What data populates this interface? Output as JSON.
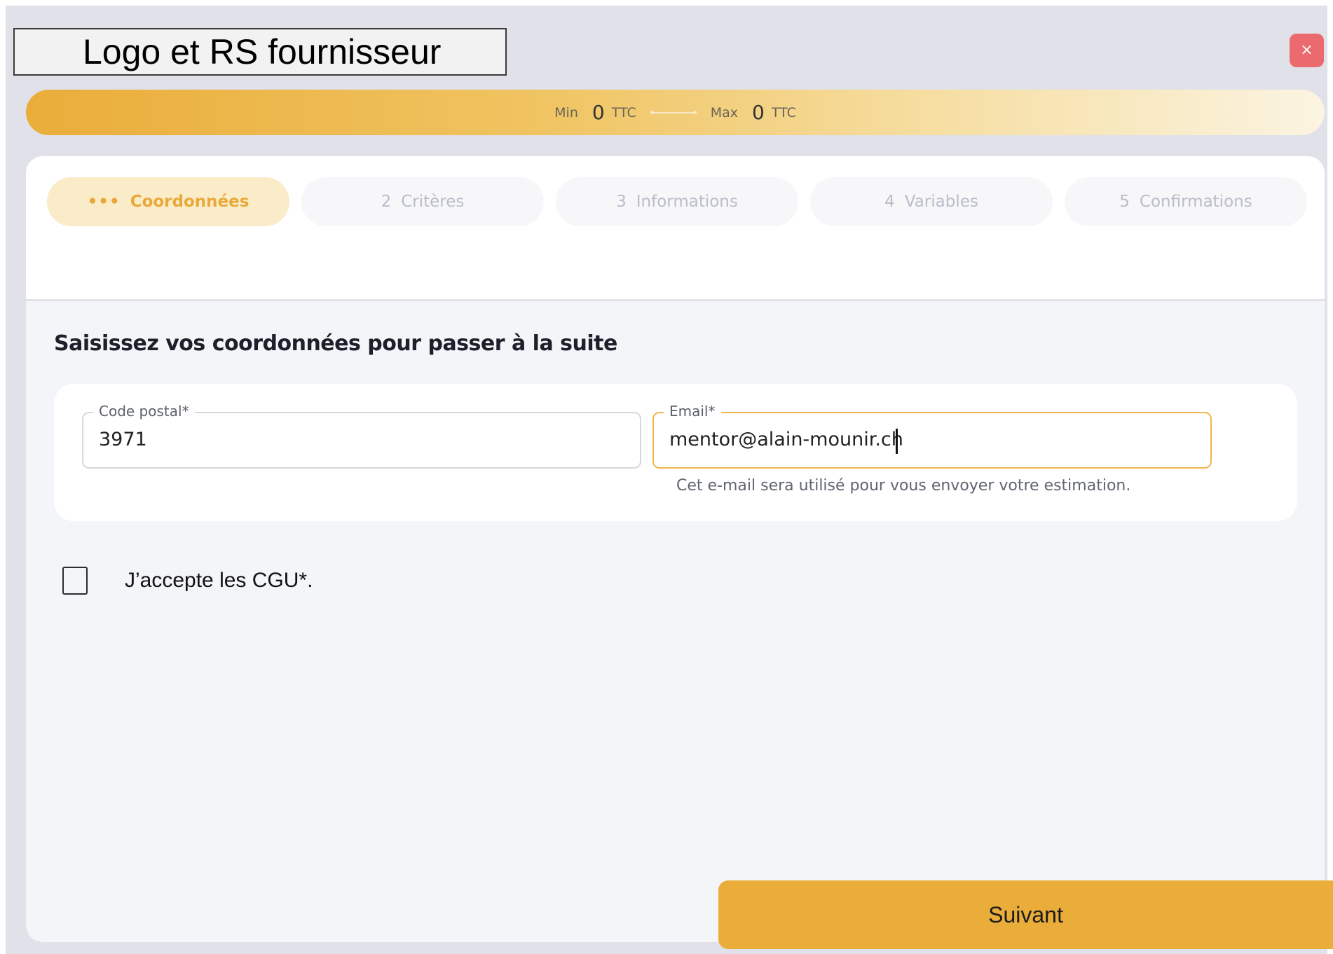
{
  "header": {
    "logo_text": "Logo et RS fournisseur",
    "close_label": "×"
  },
  "price_range": {
    "min_label": "Min",
    "min_value": "0",
    "min_unit": "TTC",
    "max_label": "Max",
    "max_value": "0",
    "max_unit": "TTC"
  },
  "steps": [
    {
      "number": "•••",
      "label": "Coordonnées",
      "active": true
    },
    {
      "number": "2",
      "label": "Critères",
      "active": false
    },
    {
      "number": "3",
      "label": "Informations",
      "active": false
    },
    {
      "number": "4",
      "label": "Variables",
      "active": false
    },
    {
      "number": "5",
      "label": "Confirmations",
      "active": false
    }
  ],
  "form": {
    "heading": "Saisissez vos coordonnées pour passer à la suite",
    "postal_code": {
      "label": "Code postal*",
      "value": "3971"
    },
    "email": {
      "label": "Email*",
      "value": "mentor@alain-mounir.ch",
      "helper": "Cet e-mail sera utilisé pour vous envoyer votre estimation."
    },
    "terms_label": "J’accepte les CGU*."
  },
  "footer": {
    "next_label": "Suivant"
  },
  "colors": {
    "accent": "#eaad3a",
    "close": "#ea6a6d",
    "active_step_bg": "#faecc8"
  }
}
